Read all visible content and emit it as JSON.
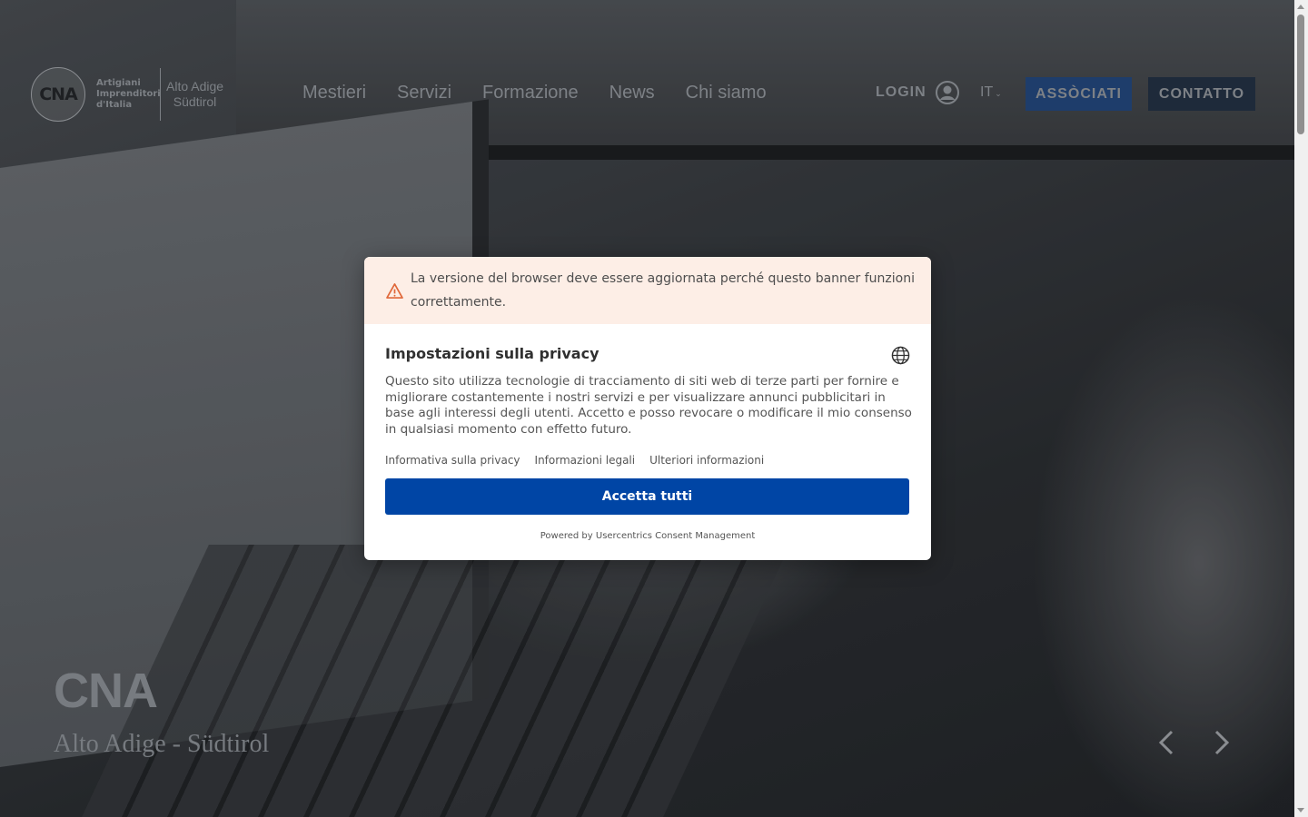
{
  "header": {
    "logo": {
      "mark": "CNA",
      "tagline": [
        "Artigiani",
        "Imprenditori",
        "d'Italia"
      ],
      "region": [
        "Alto Adige",
        "Südtirol"
      ]
    },
    "nav": [
      "Mestieri",
      "Servizi",
      "Formazione",
      "News",
      "Chi siamo"
    ],
    "login_label": "LOGIN",
    "language": "IT",
    "associati_label": "ASSÒCIATI",
    "contatto_label": "CONTATTO"
  },
  "hero": {
    "title": "CNA",
    "subtitle": "Alto Adige - Südtirol"
  },
  "privacy_modal": {
    "warning": "La versione del browser deve essere aggiornata perché questo banner funzioni correttamente.",
    "title": "Impostazioni sulla privacy",
    "description": "Questo sito utilizza tecnologie di tracciamento di siti web di terze parti per fornire e migliorare costantemente i nostri servizi e per visualizzare annunci pubblicitari in base agli interessi degli utenti. Accetto e posso revocare o modificare il mio consenso in qualsiasi momento con effetto futuro.",
    "links": [
      "Informativa sulla privacy",
      "Informazioni legali",
      "Ulteriori informazioni"
    ],
    "accept_label": "Accetta tutti",
    "powered_by": "Powered by Usercentrics Consent Management"
  },
  "colors": {
    "accept_button": "#0045a5",
    "warning_background": "#fdeee6",
    "associati_button": "#1e3d6b",
    "contatto_button": "#1e2a3a"
  },
  "icons": [
    "user-icon",
    "chevron-down-icon",
    "warning-icon",
    "globe-icon",
    "arrow-left-icon",
    "arrow-right-icon"
  ]
}
